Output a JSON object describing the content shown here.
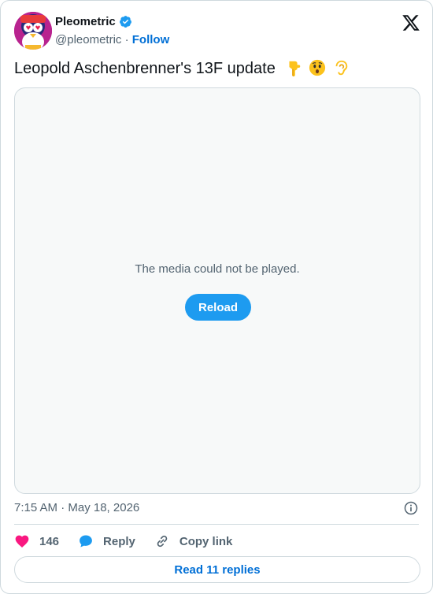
{
  "author": {
    "name": "Pleometric",
    "handle": "@pleometric",
    "separator": " · ",
    "follow_label": "Follow",
    "verified_color": "#1d9bf0"
  },
  "tweet": {
    "text": "Leopold Aschenbrenner's 13F update",
    "emojis": [
      "backhand-index-pointing-down",
      "hushed-face",
      "ear"
    ]
  },
  "media": {
    "error_message": "The media could not be played.",
    "reload_label": "Reload"
  },
  "meta": {
    "timestamp": "7:15 AM · May 18, 2026"
  },
  "actions": {
    "like_count": "146",
    "reply_label": "Reply",
    "copy_link_label": "Copy link"
  },
  "footer": {
    "read_replies_label": "Read 11 replies"
  },
  "colors": {
    "accent": "#1d9bf0",
    "link": "#006fd6",
    "like": "#f91880",
    "muted": "#536471",
    "border": "#cfd9de"
  }
}
